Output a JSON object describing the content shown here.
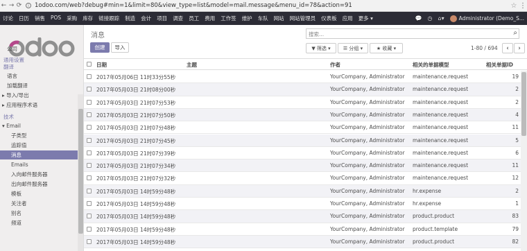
{
  "browser": {
    "url": "1odoo.com/web?debug#min=1&limit=80&view_type=list&model=mail.message&menu_id=78&action=91"
  },
  "topbar": {
    "apps": [
      "讨论",
      "日历",
      "销售",
      "POS",
      "采购",
      "库存",
      "链接跟踪",
      "制造",
      "会计",
      "项目",
      "调查",
      "员工",
      "费用",
      "工作签",
      "维护",
      "车队",
      "网站",
      "网站管理员",
      "仪表板",
      "应用",
      "更多 ▾"
    ],
    "user": "Administrator (Demo_S..."
  },
  "sidebar": {
    "logo": "odoo",
    "items": [
      {
        "label": "公司",
        "type": "item"
      },
      {
        "label": "通用设置",
        "type": "head"
      },
      {
        "label": "翻译",
        "type": "head"
      },
      {
        "label": "语言",
        "type": "item"
      },
      {
        "label": "加载翻译",
        "type": "item"
      },
      {
        "label": "导入/导出",
        "type": "group"
      },
      {
        "label": "应用程序术语",
        "type": "group"
      },
      {
        "label": "技术",
        "type": "head"
      },
      {
        "label": "Email",
        "type": "expanded"
      },
      {
        "label": "子类型",
        "type": "sub"
      },
      {
        "label": "追踪值",
        "type": "sub"
      },
      {
        "label": "消息",
        "type": "active"
      },
      {
        "label": "Emails",
        "type": "sub"
      },
      {
        "label": "入向邮件服务器",
        "type": "sub"
      },
      {
        "label": "出向邮件服务器",
        "type": "sub"
      },
      {
        "label": "模板",
        "type": "sub"
      },
      {
        "label": "关注者",
        "type": "sub"
      },
      {
        "label": "别名",
        "type": "sub"
      },
      {
        "label": "频道",
        "type": "sub"
      }
    ]
  },
  "control": {
    "title": "消息",
    "create": "创建",
    "import": "导入",
    "search_placeholder": "搜索...",
    "filters": "▼ 筛选 ▾",
    "groupby": "☰ 分组 ▾",
    "favorites": "★ 收藏 ▾",
    "pager": "1-80 / 694",
    "prev": "‹",
    "next": "›"
  },
  "table": {
    "columns": [
      "日期",
      "主题",
      "作者",
      "相关的单据模型",
      "相关单据ID"
    ],
    "rows": [
      [
        "2017年05月06日 11时33分55秒",
        "",
        "YourCompany, Administrator",
        "maintenance.request",
        "19"
      ],
      [
        "2017年05月03日 21时08分00秒",
        "",
        "YourCompany, Administrator",
        "maintenance.request",
        "2"
      ],
      [
        "2017年05月03日 21时07分53秒",
        "",
        "YourCompany, Administrator",
        "maintenance.request",
        "2"
      ],
      [
        "2017年05月03日 21时07分50秒",
        "",
        "YourCompany, Administrator",
        "maintenance.request",
        "4"
      ],
      [
        "2017年05月03日 21时07分48秒",
        "",
        "YourCompany, Administrator",
        "maintenance.request",
        "11"
      ],
      [
        "2017年05月03日 21时07分45秒",
        "",
        "YourCompany, Administrator",
        "maintenance.request",
        "5"
      ],
      [
        "2017年05月03日 21时07分39秒",
        "",
        "YourCompany, Administrator",
        "maintenance.request",
        "6"
      ],
      [
        "2017年05月03日 21时07分34秒",
        "",
        "YourCompany, Administrator",
        "maintenance.request",
        "11"
      ],
      [
        "2017年05月03日 21时07分32秒",
        "",
        "YourCompany, Administrator",
        "maintenance.request",
        "12"
      ],
      [
        "2017年05月03日 14时59分48秒",
        "",
        "YourCompany, Administrator",
        "hr.expense",
        "2"
      ],
      [
        "2017年05月03日 14时59分48秒",
        "",
        "YourCompany, Administrator",
        "hr.expense",
        "1"
      ],
      [
        "2017年05月03日 14时59分48秒",
        "",
        "YourCompany, Administrator",
        "product.product",
        "83"
      ],
      [
        "2017年05月03日 14时59分48秒",
        "",
        "YourCompany, Administrator",
        "product.template",
        "79"
      ],
      [
        "2017年05月03日 14时59分48秒",
        "",
        "YourCompany, Administrator",
        "product.product",
        "82"
      ]
    ]
  }
}
